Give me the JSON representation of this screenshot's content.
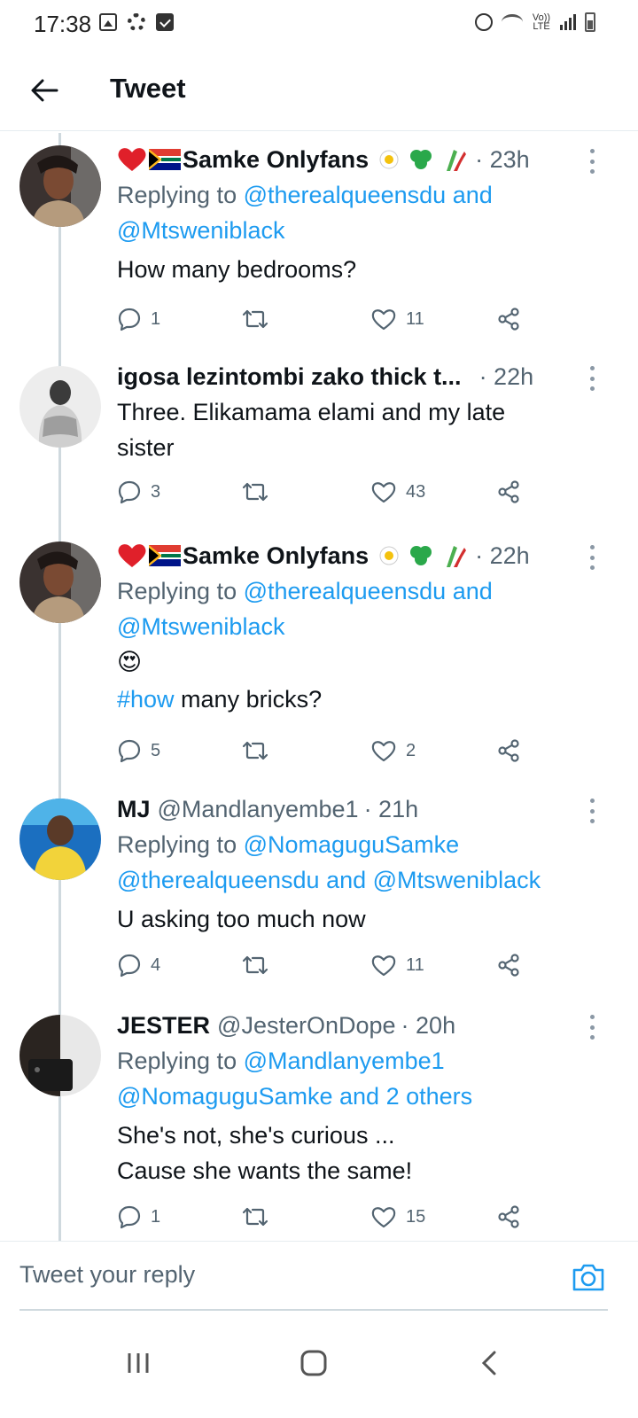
{
  "status_bar": {
    "time": "17:38",
    "volte": "Vo)) LTE"
  },
  "header": {
    "title": "Tweet"
  },
  "tweets": [
    {
      "name": "Samke Onlyfans",
      "time": "· 23h",
      "reply_prefix": "Replying to",
      "reply_handles": "@therealqueensdu and",
      "reply_handles2": "@Mtsweniblack",
      "text": "How many bedrooms?",
      "replies": "1",
      "retweets": "",
      "likes": "11"
    },
    {
      "name": "igosa lezintombi zako thick t...",
      "time": "· 22h",
      "text": "Three. Elikamama elami and my late sister",
      "replies": "3",
      "retweets": "",
      "likes": "43"
    },
    {
      "name": "Samke Onlyfans",
      "time": "· 22h",
      "reply_prefix": "Replying to",
      "reply_handles": "@therealqueensdu and",
      "reply_handles2": "@Mtsweniblack",
      "emoji": "😍",
      "hashtag": "#how",
      "text": " many bricks?",
      "replies": "5",
      "retweets": "",
      "likes": "2"
    },
    {
      "name": "MJ",
      "handle": "@Mandlanyembe1",
      "time": "· 21h",
      "reply_prefix": "Replying to",
      "reply_handles": "@NomaguguSamke",
      "reply_handles2": "@therealqueensdu and @Mtsweniblack",
      "text": "U asking too much now",
      "replies": "4",
      "retweets": "",
      "likes": "11"
    },
    {
      "name": "JESTER",
      "handle": "@JesterOnDope",
      "time": "· 20h",
      "reply_prefix": "Replying to",
      "reply_handles": "@Mandlanyembe1",
      "reply_handles2": "@NomaguguSamke and 2 others",
      "text": "She's not, she's curious ...",
      "text2": "Cause she wants the same!",
      "replies": "1",
      "retweets": "",
      "likes": "15"
    }
  ],
  "reply_bar": {
    "placeholder": "Tweet your reply"
  },
  "colors": {
    "link": "#1d9bf0",
    "muted": "#536471",
    "text": "#0f1419"
  }
}
